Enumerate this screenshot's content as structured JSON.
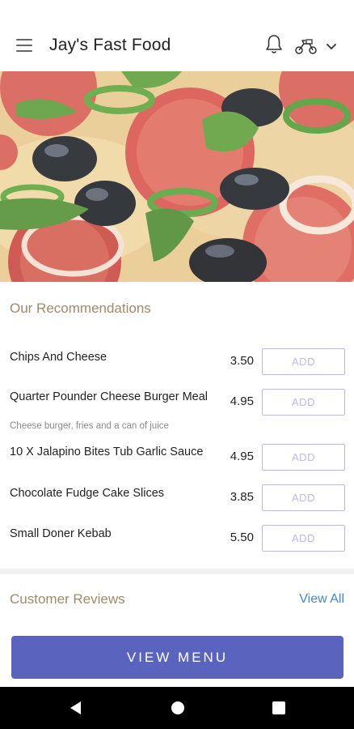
{
  "header": {
    "title": "Jay's Fast Food",
    "icons": [
      "menu-icon",
      "bell-icon",
      "scooter-icon",
      "chevron-down-icon"
    ]
  },
  "hero": {
    "icon": "pizza-image"
  },
  "recommendations": {
    "title": "Our Recommendations",
    "items": [
      {
        "name": "Chips And Cheese",
        "description": "",
        "price": "3.50",
        "button": "ADD"
      },
      {
        "name": "Quarter Pounder Cheese Burger Meal",
        "description": "Cheese burger, fries and a can of juice",
        "price": "4.95",
        "button": "ADD"
      },
      {
        "name": "10 X Jalapino Bites Tub Garlic Sauce",
        "description": "",
        "price": "4.95",
        "button": "ADD"
      },
      {
        "name": "Chocolate Fudge Cake Slices",
        "description": "",
        "price": "3.85",
        "button": "ADD"
      },
      {
        "name": "Small Doner Kebab",
        "description": "",
        "price": "5.50",
        "button": "ADD"
      }
    ]
  },
  "reviews": {
    "title": "Customer Reviews",
    "view_all": "View All"
  },
  "cta": {
    "label": "VIEW MENU"
  },
  "colors": {
    "accent": "#5a63be",
    "section_title": "#a08a6a",
    "link": "#3d8ad6",
    "add_border": "#b9bbe6"
  },
  "navbar": {
    "icons": [
      "back-icon",
      "home-icon",
      "recents-icon"
    ]
  }
}
